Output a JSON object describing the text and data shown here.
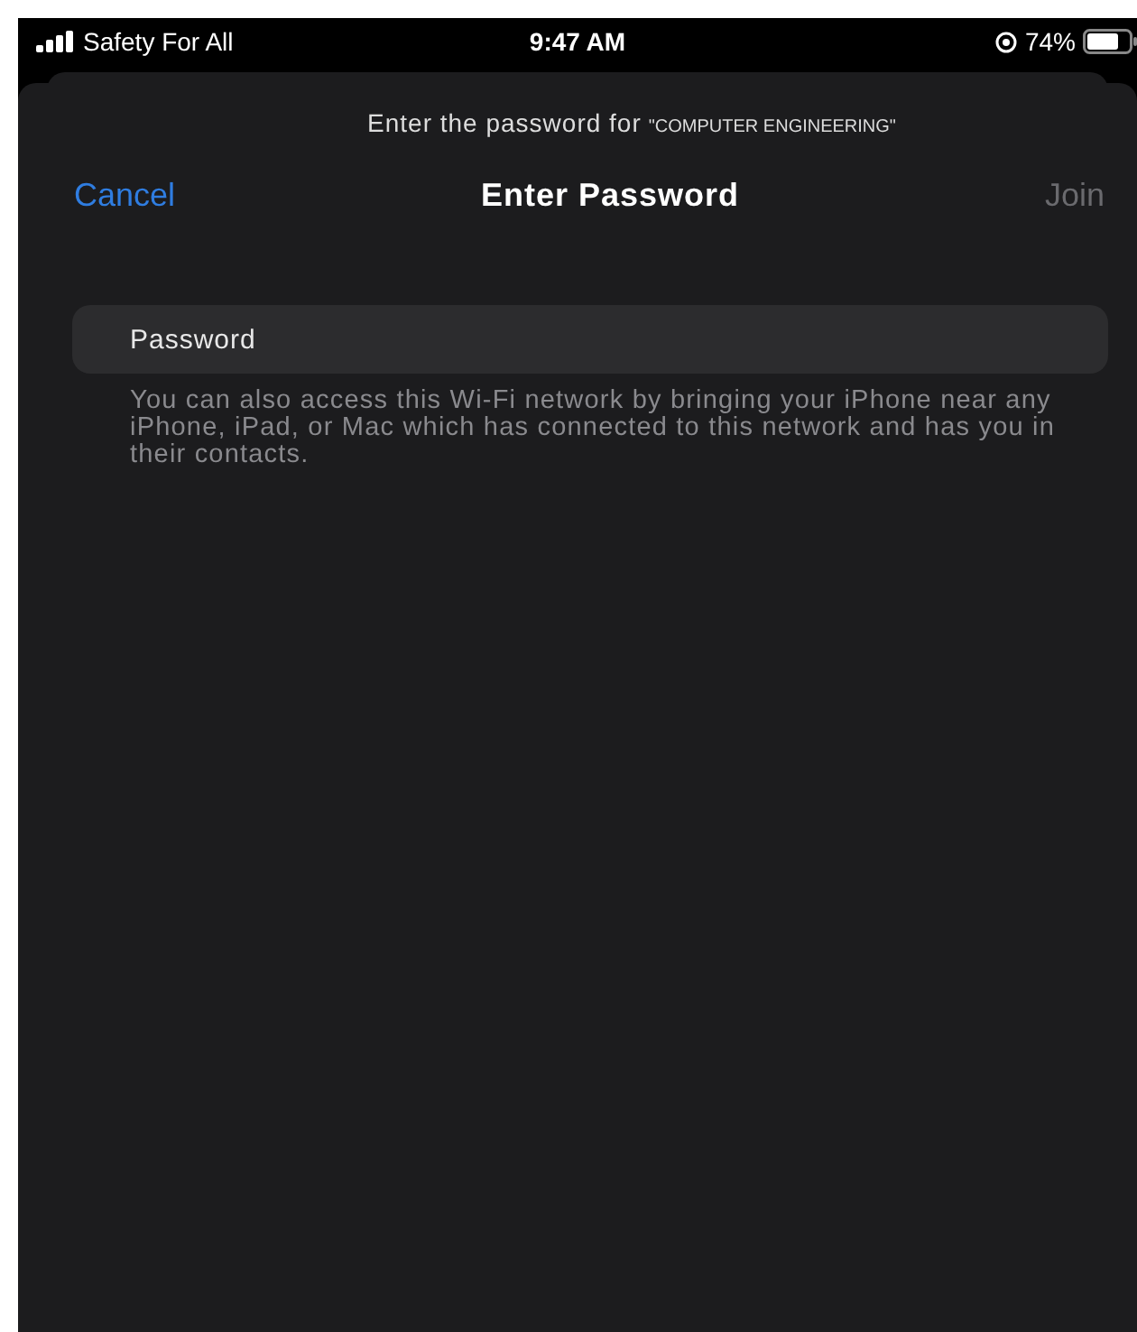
{
  "status_bar": {
    "carrier": "Safety For All",
    "time": "9:47 AM",
    "battery_percent": "74%"
  },
  "sheet": {
    "prompt": "Enter the password for",
    "network": "\"COMPUTER ENGINEERING\"",
    "nav": {
      "cancel": "Cancel",
      "title": "Enter Password",
      "join": {
        "label": "Join",
        "disabled": true
      }
    },
    "password_field": {
      "placeholder": "Password"
    },
    "hint": "You can also access this Wi-Fi network by bringing your iPhone near any iPhone, iPad, or Mac which has connected to this network and has you in their contacts."
  }
}
